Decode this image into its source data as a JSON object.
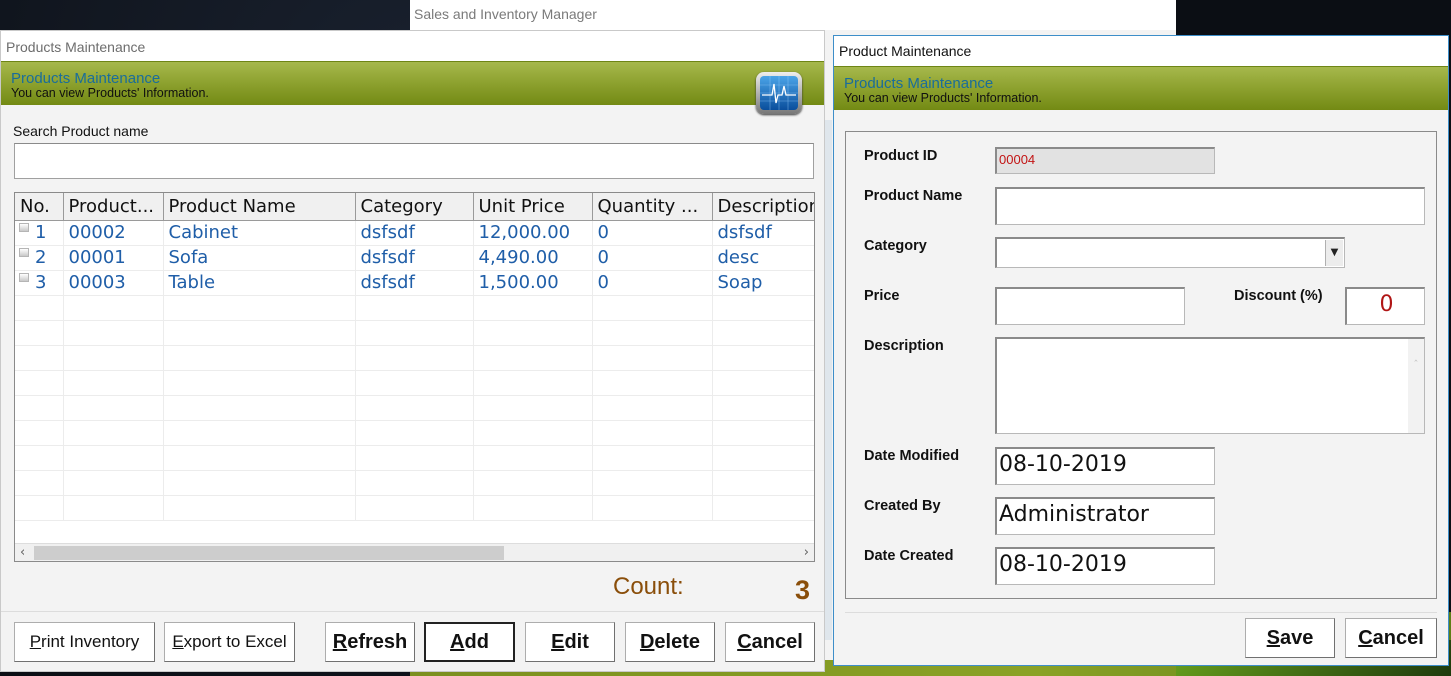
{
  "main_app": {
    "title": "Sales and Inventory Manager"
  },
  "list_window": {
    "title": "Products Maintenance",
    "banner_title": "Products Maintenance",
    "banner_subtitle": "You can view Products' Information.",
    "icon": "monitor-icon",
    "search_label": "Search Product name",
    "search_value": "",
    "columns": [
      "No.",
      "Product...",
      "Product Name",
      "Category",
      "Unit Price",
      "Quantity ...",
      "Description"
    ],
    "rows": [
      [
        "1",
        "00002",
        "Cabinet",
        "dsfsdf",
        "12,000.00",
        "0",
        "dsfsdf"
      ],
      [
        "2",
        "00001",
        "Sofa",
        "dsfsdf",
        "4,490.00",
        "0",
        "desc"
      ],
      [
        "3",
        "00003",
        "Table",
        "dsfsdf",
        "1,500.00",
        "0",
        "Soap"
      ]
    ],
    "count_label": "Count:",
    "count_value": "3",
    "buttons": {
      "print": {
        "u": "P",
        "rest": "rint Inventory"
      },
      "export": {
        "u": "E",
        "rest": "xport to Excel"
      },
      "refresh": {
        "u": "R",
        "rest": "efresh"
      },
      "add": {
        "u": "A",
        "rest": "dd"
      },
      "edit": {
        "u": "E",
        "rest": "dit"
      },
      "delete": {
        "u": "D",
        "rest": "elete"
      },
      "cancel": {
        "u": "C",
        "rest": "ancel"
      }
    }
  },
  "form_window": {
    "title": "Product Maintenance",
    "banner_title": "Products Maintenance",
    "banner_subtitle": "You can view Products' Information.",
    "fields": {
      "product_id": {
        "label": "Product ID",
        "value": "00004"
      },
      "product_name": {
        "label": "Product Name",
        "value": ""
      },
      "category": {
        "label": "Category",
        "value": ""
      },
      "price": {
        "label": "Price",
        "value": ""
      },
      "discount": {
        "label": "Discount (%)",
        "value": "0"
      },
      "description": {
        "label": "Description",
        "value": ""
      },
      "date_modified": {
        "label": "Date Modified",
        "value": "08-10-2019"
      },
      "created_by": {
        "label": "Created By",
        "value": "Administrator"
      },
      "date_created": {
        "label": "Date Created",
        "value": "08-10-2019"
      }
    },
    "buttons": {
      "save": {
        "u": "S",
        "rest": "ave"
      },
      "cancel": {
        "u": "C",
        "rest": "ancel"
      }
    }
  }
}
